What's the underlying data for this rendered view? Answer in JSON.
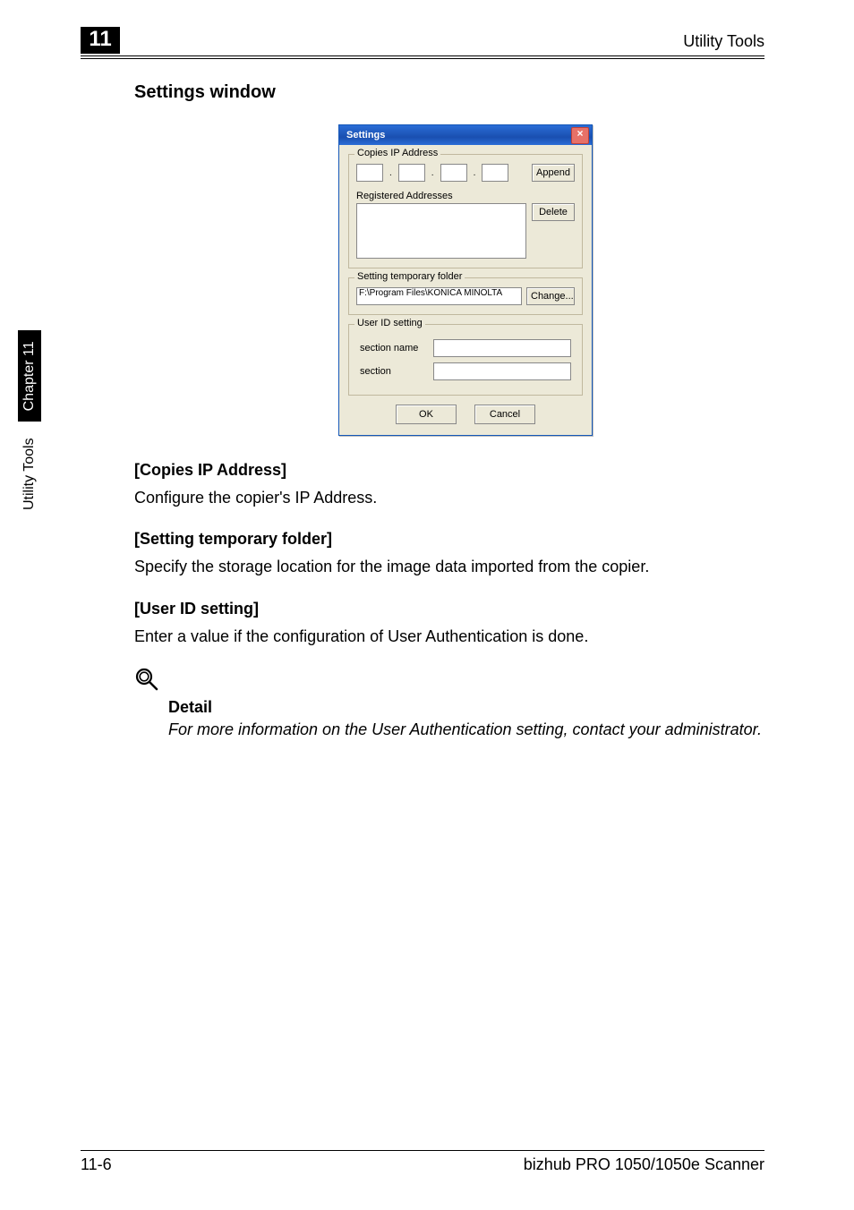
{
  "header": {
    "chapter_number": "11",
    "section_title": "Utility Tools"
  },
  "side": {
    "label1": "Utility Tools",
    "label2": "Chapter 11"
  },
  "content": {
    "heading": "Settings window",
    "dialog": {
      "title": "Settings",
      "close_glyph": "×",
      "group_ip_legend": "Copies IP Address",
      "append_label": "Append",
      "registered_label": "Registered Addresses",
      "delete_label": "Delete",
      "group_folder_legend": "Setting temporary folder",
      "folder_path": "F:\\Program Files\\KONICA MINOLTA",
      "change_label": "Change...",
      "group_user_legend": "User ID setting",
      "section_name_label": "section name",
      "section_label": "section",
      "ok_label": "OK",
      "cancel_label": "Cancel"
    },
    "sec1_title": "[Copies IP Address]",
    "sec1_body": "Configure the copier's IP Address.",
    "sec2_title": "[Setting temporary folder]",
    "sec2_body": "Specify the storage location for the image data imported from the copier.",
    "sec3_title": "[User ID setting]",
    "sec3_body": "Enter a value if the configuration of User Authentication is done.",
    "detail_heading": "Detail",
    "detail_body": "For more information on the User Authentication setting, contact your administrator."
  },
  "footer": {
    "left": "11-6",
    "right": "bizhub PRO 1050/1050e Scanner"
  }
}
